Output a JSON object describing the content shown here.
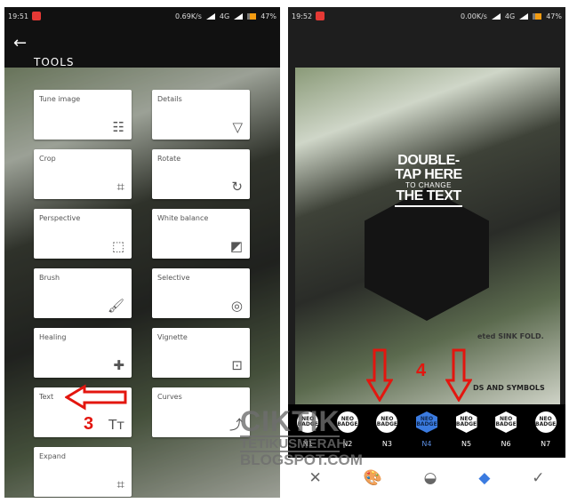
{
  "left_screen": {
    "status": {
      "time": "19:51",
      "speed": "0.69K/s",
      "network": "4G",
      "battery": "47%"
    },
    "header": {
      "back_icon": "arrow-left-icon",
      "title": "TOOLS"
    },
    "tools": [
      {
        "label": "Tune image",
        "icon": "sliders-icon",
        "glyph": "☷"
      },
      {
        "label": "Details",
        "icon": "triangle-down-icon",
        "glyph": "▽"
      },
      {
        "label": "Crop",
        "icon": "crop-icon",
        "glyph": "⌗"
      },
      {
        "label": "Rotate",
        "icon": "rotate-icon",
        "glyph": "↻"
      },
      {
        "label": "Perspective",
        "icon": "perspective-icon",
        "glyph": "⬚"
      },
      {
        "label": "White balance",
        "icon": "white-balance-icon",
        "glyph": "◩"
      },
      {
        "label": "Brush",
        "icon": "brush-icon",
        "glyph": "🖌"
      },
      {
        "label": "Selective",
        "icon": "selective-icon",
        "glyph": "◎"
      },
      {
        "label": "Healing",
        "icon": "bandage-icon",
        "glyph": "✚"
      },
      {
        "label": "Vignette",
        "icon": "vignette-icon",
        "glyph": "⊡"
      },
      {
        "label": "Text",
        "icon": "text-icon",
        "glyph": "Tт"
      },
      {
        "label": "Curves",
        "icon": "curves-icon",
        "glyph": "⤴"
      },
      {
        "label": "Expand",
        "icon": "expand-icon",
        "glyph": "⌗"
      }
    ],
    "annotation": {
      "step": "3",
      "color": "#e3160f"
    }
  },
  "right_screen": {
    "status": {
      "time": "19:52",
      "speed": "0.00K/s",
      "network": "4G",
      "battery": "47%"
    },
    "overlay_text": {
      "line1": "DOUBLE-",
      "line2": "TAP HERE",
      "line3": "TO CHANGE",
      "line4": "THE TEXT"
    },
    "photo_text": {
      "a": "eted SINK FOLD.",
      "b": "DS AND SYMBOLS"
    },
    "badges": [
      {
        "name": "N1",
        "text": "NEO BADGE",
        "shape": "circle"
      },
      {
        "name": "N2",
        "text": "NEO BADGE",
        "shape": "circle"
      },
      {
        "name": "N3",
        "text": "NEO BADGE",
        "shape": "circle"
      },
      {
        "name": "N4",
        "text": "NEO BADGE",
        "shape": "hexagon",
        "selected": true
      },
      {
        "name": "N5",
        "text": "NEO BADGE",
        "shape": "hexagon"
      },
      {
        "name": "N6",
        "text": "NEO BADGE",
        "shape": "hexagon"
      },
      {
        "name": "N7",
        "text": "NEO BADGE",
        "shape": "circle"
      }
    ],
    "toolbar": [
      {
        "icon": "close-icon",
        "glyph": "✕"
      },
      {
        "icon": "palette-icon",
        "glyph": "🎨"
      },
      {
        "icon": "opacity-icon",
        "glyph": "◒"
      },
      {
        "icon": "styles-icon",
        "glyph": "◆",
        "active": true
      },
      {
        "icon": "check-icon",
        "glyph": "✓"
      }
    ],
    "annotation": {
      "step": "4",
      "color": "#e3160f"
    },
    "accent": "#3b7be0"
  },
  "watermark": {
    "line1": "CIKTIK",
    "line2": "TETIKUSMERAH",
    "line3": "BLOGSPOT.COM"
  }
}
